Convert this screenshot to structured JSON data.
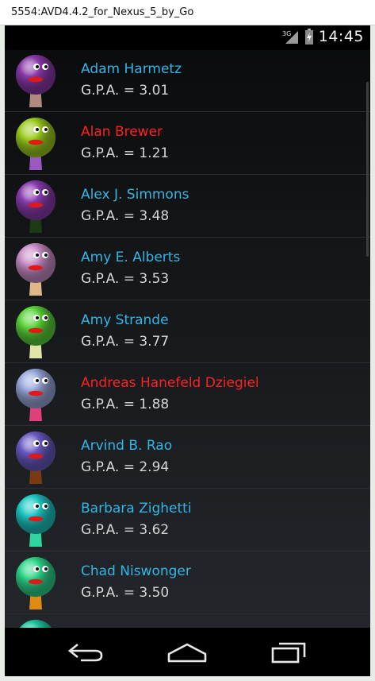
{
  "window": {
    "title": "5554:AVD4.4.2_for_Nexus_5_by_Go"
  },
  "statusbar": {
    "time": "14:45",
    "network_icon": "3g-signal-icon",
    "battery_icon": "battery-icon",
    "network_label": "3G"
  },
  "colors": {
    "good": "#33b5e5",
    "bad": "#ff2020",
    "gpa_text": "#d6d6d6"
  },
  "students": [
    {
      "name": "Adam Harmetz",
      "gpa": "G.P.A. = 3.01",
      "status": "good",
      "head": "#8a3aa8",
      "stem": "#b08a80"
    },
    {
      "name": "Alan Brewer",
      "gpa": "G.P.A. = 1.21",
      "status": "bad",
      "head": "#9ccc1e",
      "stem": "#9a58c0"
    },
    {
      "name": "Alex J. Simmons",
      "gpa": "G.P.A. = 3.48",
      "status": "good",
      "head": "#8a3cb0",
      "stem": "#1e3a14"
    },
    {
      "name": "Amy E. Alberts",
      "gpa": "G.P.A. = 3.53",
      "status": "good",
      "head": "#c98fc8",
      "stem": "#e0b888"
    },
    {
      "name": "Amy Strande",
      "gpa": "G.P.A. = 3.77",
      "status": "good",
      "head": "#5cd43a",
      "stem": "#dfe6a8"
    },
    {
      "name": "Andreas Hanefeld Dziegiel",
      "gpa": "G.P.A. = 1.88",
      "status": "bad",
      "head": "#9aa8dc",
      "stem": "#e0407a"
    },
    {
      "name": "Arvind B. Rao",
      "gpa": "G.P.A. = 2.94",
      "status": "good",
      "head": "#6a5ac4",
      "stem": "#7a3a10"
    },
    {
      "name": "Barbara Zighetti",
      "gpa": "G.P.A. = 3.62",
      "status": "good",
      "head": "#1ec8c4",
      "stem": "#2ed6a0"
    },
    {
      "name": "Chad Niswonger",
      "gpa": "G.P.A. = 3.50",
      "status": "good",
      "head": "#2ed68a",
      "stem": "#e08a14"
    },
    {
      "name": "",
      "gpa": "",
      "status": "good",
      "head": "#20c8a0",
      "stem": "#888888"
    }
  ],
  "navbar": {
    "back": "back-icon",
    "home": "home-icon",
    "recents": "recent-apps-icon"
  }
}
